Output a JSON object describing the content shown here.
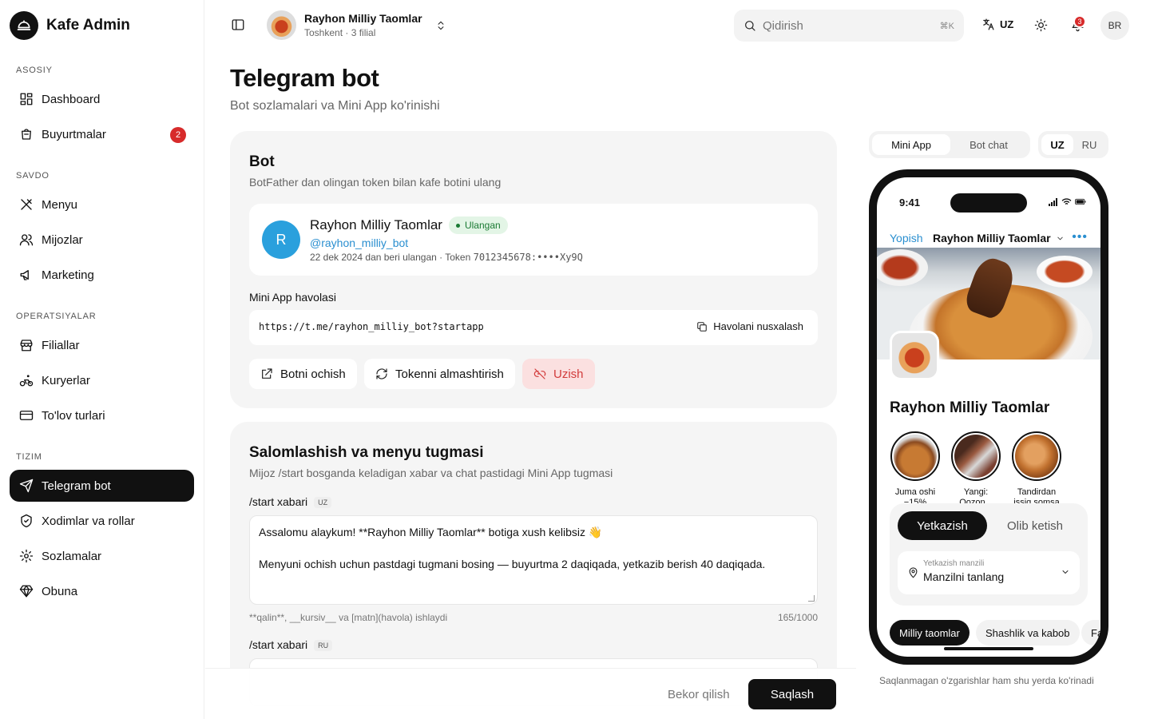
{
  "sidebar": {
    "brand": "Kafe Admin",
    "sections": [
      "ASOSIY",
      "SAVDO",
      "OPERATSIYALAR",
      "TIZIM"
    ],
    "items": [
      {
        "label": "Dashboard",
        "icon": "dashboard-icon"
      },
      {
        "label": "Buyurtmalar",
        "icon": "orders-icon",
        "badge": "2"
      },
      {
        "label": "Menyu",
        "icon": "utensils-icon"
      },
      {
        "label": "Mijozlar",
        "icon": "users-icon"
      },
      {
        "label": "Marketing",
        "icon": "megaphone-icon"
      },
      {
        "label": "Filiallar",
        "icon": "store-icon"
      },
      {
        "label": "Kuryerlar",
        "icon": "bike-icon"
      },
      {
        "label": "To'lov turlari",
        "icon": "card-icon"
      },
      {
        "label": "Telegram bot",
        "icon": "send-icon",
        "active": true
      },
      {
        "label": "Xodimlar va rollar",
        "icon": "shield-icon"
      },
      {
        "label": "Sozlamalar",
        "icon": "gear-icon"
      },
      {
        "label": "Obuna",
        "icon": "gem-icon"
      }
    ]
  },
  "topbar": {
    "cafe_name": "Rayhon Milliy Taomlar",
    "cafe_sub": "Toshkent · 3 filial",
    "search_placeholder": "Qidirish",
    "search_shortcut": "⌘K",
    "lang": "UZ",
    "notif_count": "3",
    "avatar": "BR"
  },
  "page": {
    "title": "Telegram bot",
    "subtitle": "Bot sozlamalari va Mini App ko'rinishi"
  },
  "bot_card": {
    "title": "Bot",
    "desc": "BotFather dan olingan token bilan kafe botini ulang",
    "avatar_letter": "R",
    "bot_name": "Rayhon Milliy Taomlar",
    "status": "Ulangan",
    "handle": "@rayhon_milliy_bot",
    "meta_prefix": "22 dek 2024 dan beri ulangan · Token ",
    "token": "7012345678:••••Xy9Q",
    "link_label": "Mini App havolasi",
    "link": "https://t.me/rayhon_milliy_bot?startapp",
    "copy_label": "Havolani nusxalash",
    "open_label": "Botni ochish",
    "refresh_label": "Tokenni almashtirish",
    "disconnect_label": "Uzish"
  },
  "greet_card": {
    "title": "Salomlashish va menyu tugmasi",
    "desc": "Mijoz /start bosganda keladigan xabar va chat pastidagi Mini App tugmasi",
    "field_label": "/start xabari",
    "tag_uz": "UZ",
    "tag_ru": "RU",
    "message_line1": "Assalomu alaykum! **Rayhon Milliy Taomlar** botiga xush kelibsiz 👋",
    "message_line2": "Menyuni ochish uchun pastdagi tugmani bosing — buyurtma 2 daqiqada, yetkazib berish 40 daqiqada.",
    "hint": "**qalin**, __kursiv__ va [matn](havola) ishlaydi",
    "counter": "165/1000"
  },
  "footer": {
    "cancel": "Bekor qilish",
    "save": "Saqlash"
  },
  "preview": {
    "tabs": [
      "Mini App",
      "Bot chat"
    ],
    "langs": [
      "UZ",
      "RU"
    ],
    "time": "9:41",
    "close": "Yopish",
    "header_name": "Rayhon Milliy Taomlar",
    "cafe_title": "Rayhon Milliy Taomlar",
    "stories": [
      "Juma oshi −15%",
      "Yangi: Qozon...",
      "Tandirdan issiq somsa"
    ],
    "delivery": "Yetkazish",
    "pickup": "Olib ketish",
    "address_label": "Yetkazish manzili",
    "address_value": "Manzilni tanlang",
    "categories": [
      "Milliy taomlar",
      "Shashlik va kabob",
      "Fa"
    ],
    "note": "Saqlanmagan o'zgarishlar ham shu yerda ko'rinadi"
  }
}
